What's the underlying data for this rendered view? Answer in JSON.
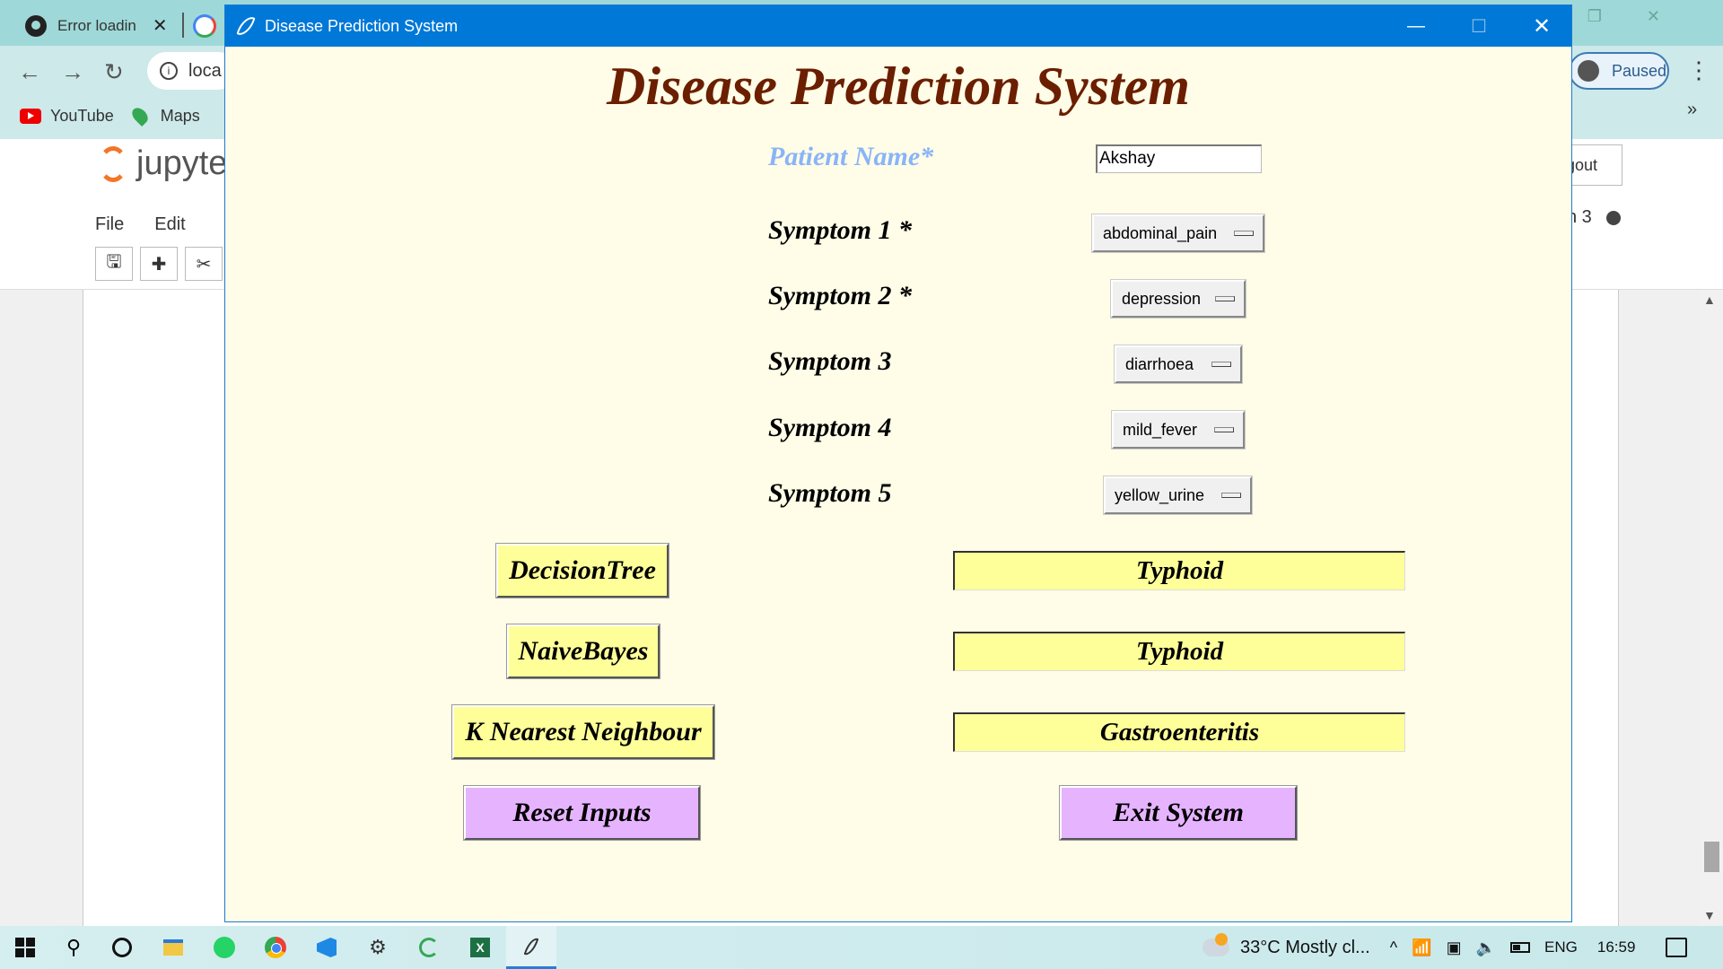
{
  "browser": {
    "tabs": [
      {
        "label": "Error loadin"
      }
    ],
    "address": "loca",
    "bookmarks": [
      {
        "label": "YouTube"
      },
      {
        "label": "Maps"
      }
    ],
    "profile_label": "Paused"
  },
  "jupyter": {
    "logo_text": "jupyte",
    "menu": [
      {
        "label": "File"
      },
      {
        "label": "Edit"
      }
    ],
    "logout_label": "gout",
    "kernel_label": "n 3"
  },
  "app": {
    "window_title": "Disease Prediction System",
    "heading": "Disease Prediction System",
    "patient_name_label": "Patient Name*",
    "patient_name_value": "Akshay",
    "symptoms": [
      {
        "label": "Symptom 1 *",
        "value": "abdominal_pain"
      },
      {
        "label": "Symptom 2 *",
        "value": "depression"
      },
      {
        "label": "Symptom 3",
        "value": "diarrhoea"
      },
      {
        "label": "Symptom 4",
        "value": "mild_fever"
      },
      {
        "label": "Symptom 5",
        "value": "yellow_urine"
      }
    ],
    "algorithms": [
      {
        "label": "DecisionTree",
        "result": "Typhoid"
      },
      {
        "label": "NaiveBayes",
        "result": "Typhoid"
      },
      {
        "label": "K Nearest Neighbour",
        "result": "Gastroenteritis"
      }
    ],
    "reset_label": "Reset Inputs",
    "exit_label": "Exit System",
    "colors": {
      "title_bar": "#0078d7",
      "background": "#fffde7",
      "heading": "#6b1e00",
      "name_label": "#8ab4f8",
      "algo_button": "#ffff99",
      "action_button": "#e6b3ff"
    }
  },
  "taskbar": {
    "weather": "33°C  Mostly cl...",
    "language": "ENG",
    "time": "16:59"
  }
}
